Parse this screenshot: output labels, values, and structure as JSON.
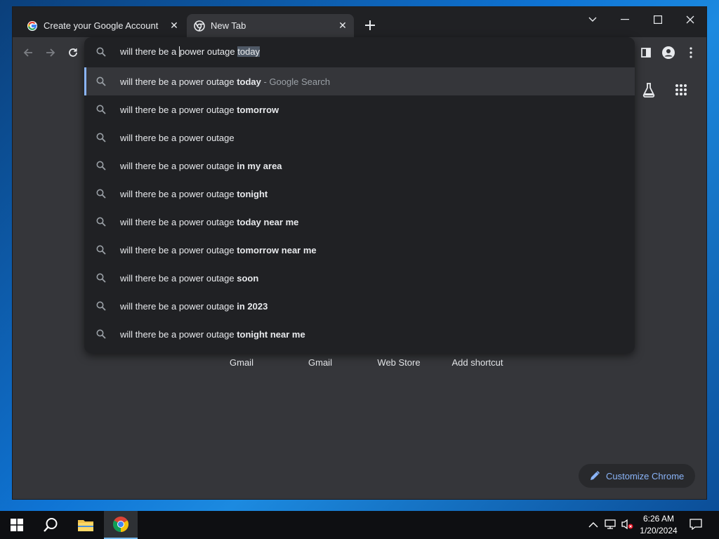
{
  "browser": {
    "tabs": [
      {
        "title": "Create your Google Account",
        "icon": "google-g-icon",
        "active": false
      },
      {
        "title": "New Tab",
        "icon": "chrome-icon",
        "active": true
      }
    ],
    "close_symbol": "✕"
  },
  "omnibox": {
    "typed_text": "will there be a power outage ",
    "typed_prefix": "will there be a",
    "typed_rest": "power outage ",
    "autocomplete_selection": "today",
    "suggestions": [
      {
        "base": "will there be a power outage ",
        "bold": "today",
        "hint": " - Google Search",
        "selected": true
      },
      {
        "base": "will there be a power outage ",
        "bold": "tomorrow",
        "hint": "",
        "selected": false
      },
      {
        "base": "will there be a power outage",
        "bold": "",
        "hint": "",
        "selected": false
      },
      {
        "base": "will there be a power outage ",
        "bold": "in my area",
        "hint": "",
        "selected": false
      },
      {
        "base": "will there be a power outage ",
        "bold": "tonight",
        "hint": "",
        "selected": false
      },
      {
        "base": "will there be a power outage ",
        "bold": "today near me",
        "hint": "",
        "selected": false
      },
      {
        "base": "will there be a power outage ",
        "bold": "tomorrow near me",
        "hint": "",
        "selected": false
      },
      {
        "base": "will there be a power outage ",
        "bold": "soon",
        "hint": "",
        "selected": false
      },
      {
        "base": "will there be a power outage ",
        "bold": "in 2023",
        "hint": "",
        "selected": false
      },
      {
        "base": "will there be a power outage ",
        "bold": "tonight near me",
        "hint": "",
        "selected": false
      }
    ]
  },
  "new_tab_page": {
    "shortcuts": [
      "Gmail",
      "Gmail",
      "Web Store",
      "Add shortcut"
    ],
    "customize_label": "Customize Chrome"
  },
  "taskbar": {
    "time": "6:26 AM",
    "date": "1/20/2024"
  },
  "colors": {
    "accent": "#8ab4f8",
    "dark_bg": "#202124",
    "surface": "#35363a"
  }
}
